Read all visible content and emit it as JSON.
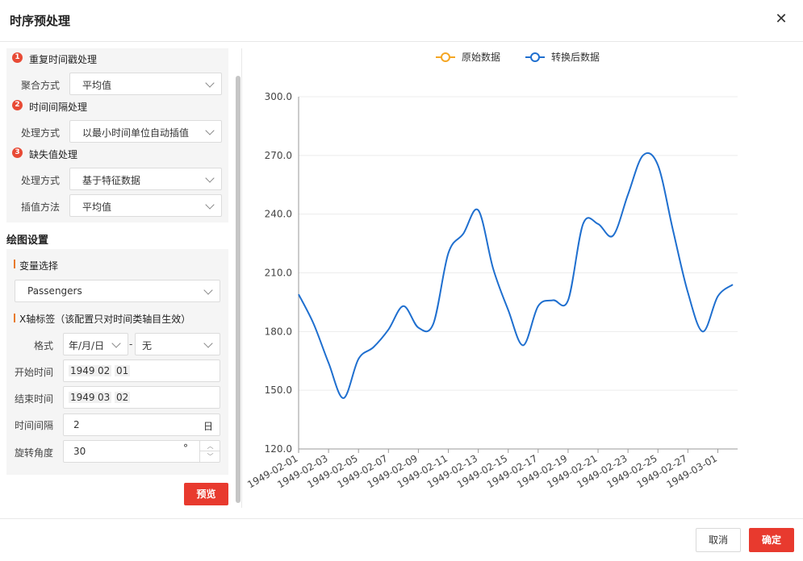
{
  "dialog": {
    "title": "时序预处理",
    "close_icon": "close-icon",
    "cancel_label": "取消",
    "ok_label": "确定"
  },
  "preprocess": {
    "duplicate": {
      "badge": "1",
      "title": "重复时间戳处理",
      "agg_label": "聚合方式",
      "agg_value": "平均值"
    },
    "interval": {
      "badge": "2",
      "title": "时间间隔处理",
      "method_label": "处理方式",
      "method_value": "以最小时间单位自动插值"
    },
    "missing": {
      "badge": "3",
      "title": "缺失值处理",
      "method_label": "处理方式",
      "method_value": "基于特征数据",
      "interp_label": "插值方法",
      "interp_value": "平均值"
    }
  },
  "plot_settings": {
    "title": "绘图设置",
    "var_title": "变量选择",
    "var_value": "Passengers",
    "xaxis_title": "X轴标签（该配置只对时间类轴目生效）",
    "format_label": "格式",
    "format_value": "年/月/日",
    "format_dash": "-",
    "format_time_value": "无",
    "start_label": "开始时间",
    "start_y": "1949",
    "start_m": "02",
    "start_d": "01",
    "end_label": "结束时间",
    "end_y": "1949",
    "end_m": "03",
    "end_d": "02",
    "interval_label": "时间间隔",
    "interval_value": "2",
    "interval_unit": "日",
    "rotate_label": "旋转角度",
    "rotate_value": "30",
    "rotate_unit": "°",
    "preview_label": "预览"
  },
  "chart_data": {
    "type": "line",
    "legend": [
      "原始数据",
      "转换后数据"
    ],
    "legend_position": "top-center",
    "series_colors": [
      "#f5a623",
      "#1f6fcf"
    ],
    "ylim": [
      120,
      300
    ],
    "yticks": [
      "120.0",
      "150.0",
      "180.0",
      "210.0",
      "240.0",
      "270.0",
      "300.0"
    ],
    "x_tick_labels": [
      "1949-02-01",
      "1949-02-03",
      "1949-02-05",
      "1949-02-07",
      "1949-02-09",
      "1949-02-11",
      "1949-02-13",
      "1949-02-15",
      "1949-02-17",
      "1949-02-19",
      "1949-02-21",
      "1949-02-23",
      "1949-02-25",
      "1949-02-27",
      "1949-03-01"
    ],
    "x_label_rotation": 30,
    "grid": true,
    "series": [
      {
        "name": "转换后数据",
        "x": [
          "1949-02-01",
          "1949-02-02",
          "1949-02-03",
          "1949-02-04",
          "1949-02-05",
          "1949-02-06",
          "1949-02-07",
          "1949-02-08",
          "1949-02-09",
          "1949-02-10",
          "1949-02-11",
          "1949-02-12",
          "1949-02-13",
          "1949-02-14",
          "1949-02-15",
          "1949-02-16",
          "1949-02-17",
          "1949-02-18",
          "1949-02-19",
          "1949-02-20",
          "1949-02-21",
          "1949-02-22",
          "1949-02-23",
          "1949-02-24",
          "1949-02-25",
          "1949-02-26",
          "1949-02-27",
          "1949-02-28",
          "1949-03-01",
          "1949-03-02"
        ],
        "values": [
          199,
          184,
          164,
          146,
          166,
          172,
          181,
          193,
          182,
          184,
          220,
          230,
          242,
          212,
          191,
          173,
          193,
          196,
          196,
          235,
          235,
          229,
          250,
          270,
          265,
          232,
          200,
          180,
          198,
          204
        ]
      }
    ]
  }
}
